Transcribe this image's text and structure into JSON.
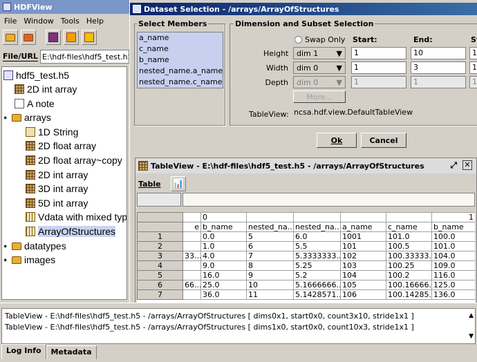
{
  "main_window": {
    "title": "HDFView",
    "menu": [
      "File",
      "Window",
      "Tools",
      "Help"
    ],
    "file_url_label": "File/URL",
    "file_url_value": "E:\\hdf-files\\hdf5_test.h5",
    "tree": [
      {
        "label": "hdf5_test.h5",
        "icon": "file-icon"
      },
      {
        "label": "2D int array",
        "icon": "dataset-icon"
      },
      {
        "label": "A note",
        "icon": "note-icon"
      },
      {
        "label": "arrays",
        "icon": "folder-icon"
      },
      {
        "label": "1D String",
        "icon": "text-dataset-icon"
      },
      {
        "label": "2D float array",
        "icon": "dataset-icon"
      },
      {
        "label": "2D float array~copy",
        "icon": "dataset-icon"
      },
      {
        "label": "2D int array",
        "icon": "dataset-icon"
      },
      {
        "label": "3D int array",
        "icon": "dataset-icon"
      },
      {
        "label": "5D int array",
        "icon": "dataset-icon"
      },
      {
        "label": "Vdata with mixed typ",
        "icon": "vdata-icon"
      },
      {
        "label": "ArrayOfStructures",
        "icon": "vdata-icon"
      },
      {
        "label": "datatypes",
        "icon": "folder-icon"
      },
      {
        "label": "images",
        "icon": "folder-icon"
      }
    ],
    "log_lines": [
      "TableView - E:\\hdf-files\\hdf5_test.h5 - /arrays/ArrayOfStructures [ dims0x1, start0x0, count3x10, stride1x1 ]",
      "TableView - E:\\hdf-files\\hdf5_test.h5 - /arrays/ArrayOfStructures [ dims1x0, start0x0, count10x3, stride1x1 ]"
    ],
    "log_tabs": [
      "Log Info",
      "Metadata"
    ]
  },
  "dialog": {
    "title": "Dataset Selection - /arrays/ArrayOfStructures",
    "members_label": "Select Members",
    "members": [
      "a_name",
      "c_name",
      "b_name",
      "nested_name.a_name",
      "nested_name.c_name"
    ],
    "subset_label": "Dimension and Subset Selection",
    "swap_only": "Swap Only",
    "start_label": "Start:",
    "end_label": "End:",
    "stride_label": "St",
    "rows": [
      {
        "label": "Height",
        "dim": "dim 1",
        "start": "1",
        "end": "10",
        "stride": "1"
      },
      {
        "label": "Width",
        "dim": "dim 0",
        "start": "1",
        "end": "3",
        "stride": "1"
      },
      {
        "label": "Depth",
        "dim": "dim 0",
        "start": "1",
        "end": "1",
        "stride": "1"
      }
    ],
    "more_button": "More...",
    "tableview_label": "TableView:",
    "tableview_value": "ncsa.hdf.view.DefaultTableView",
    "ok_button": "Ok",
    "cancel_button": "Cancel"
  },
  "table_view": {
    "title": "TableView - E:\\hdf-files\\hdf5_test.h5 - /arrays/ArrayOfStructures",
    "menu": "Table",
    "group_headers": [
      "0",
      "1"
    ],
    "columns": [
      "e",
      "b_name",
      "nested_na...",
      "nested_na...",
      "a_name",
      "c_name",
      "b_name"
    ],
    "rows": [
      {
        "n": "1",
        "cells": [
          "",
          "0.0",
          "5",
          "6.0",
          "1001",
          "101.0",
          "100.0"
        ]
      },
      {
        "n": "2",
        "cells": [
          "",
          "1.0",
          "6",
          "5.5",
          "101",
          "100.5",
          "101.0"
        ]
      },
      {
        "n": "3",
        "cells": [
          "33...",
          "4.0",
          "7",
          "5.3333333...",
          "102",
          "100.33333...",
          "104.0"
        ]
      },
      {
        "n": "4",
        "cells": [
          "",
          "9.0",
          "8",
          "5.25",
          "103",
          "100.25",
          "109.0"
        ]
      },
      {
        "n": "5",
        "cells": [
          "",
          "16.0",
          "9",
          "5.2",
          "104",
          "100.2",
          "116.0"
        ]
      },
      {
        "n": "6",
        "cells": [
          "66...",
          "25.0",
          "10",
          "5.1666666...",
          "105",
          "100.16666...",
          "125.0"
        ]
      },
      {
        "n": "7",
        "cells": [
          "",
          "36.0",
          "11",
          "5.1428571...",
          "106",
          "100.14285...",
          "136.0"
        ]
      }
    ]
  }
}
